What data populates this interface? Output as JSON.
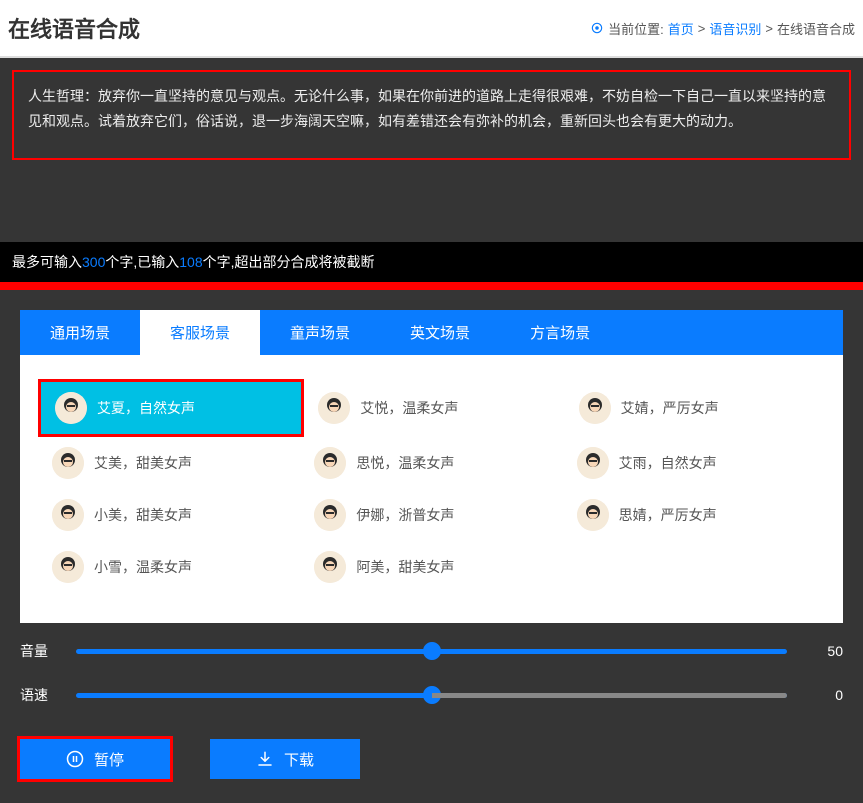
{
  "header": {
    "title": "在线语音合成",
    "breadcrumb_label": "当前位置:",
    "crumb_home": "首页",
    "crumb_mid": "语音识别",
    "crumb_last": "在线语音合成",
    "sep": ">"
  },
  "input": {
    "text": "人生哲理：放弃你一直坚持的意见与观点。无论什么事，如果在你前进的道路上走得很艰难，不妨自检一下自己一直以来坚持的意见和观点。试着放弃它们，俗话说，退一步海阔天空嘛，如有差错还会有弥补的机会，重新回头也会有更大的动力。"
  },
  "status": {
    "prefix": "最多可输入",
    "max": "300",
    "mid1": "个字,已输入",
    "current": "108",
    "suffix": "个字,超出部分合成将被截断"
  },
  "tabs": [
    {
      "label": "通用场景",
      "active": false
    },
    {
      "label": "客服场景",
      "active": true
    },
    {
      "label": "童声场景",
      "active": false
    },
    {
      "label": "英文场景",
      "active": false
    },
    {
      "label": "方言场景",
      "active": false
    }
  ],
  "voices": {
    "row0": [
      {
        "label": "艾夏，自然女声",
        "selected": true
      },
      {
        "label": "艾悦，温柔女声"
      },
      {
        "label": "艾婧，严厉女声"
      }
    ],
    "row1": [
      {
        "label": "艾美，甜美女声"
      },
      {
        "label": "思悦，温柔女声"
      },
      {
        "label": "艾雨，自然女声"
      }
    ],
    "row2": [
      {
        "label": "小美，甜美女声"
      },
      {
        "label": "伊娜，浙普女声"
      },
      {
        "label": "思婧，严厉女声"
      }
    ],
    "row3": [
      {
        "label": "小雪，温柔女声"
      },
      {
        "label": "阿美，甜美女声"
      },
      {
        "label": "",
        "empty": true
      }
    ]
  },
  "sliders": {
    "volume_label": "音量",
    "volume_value": "50",
    "speed_label": "语速",
    "speed_value": "0"
  },
  "actions": {
    "pause": "暂停",
    "download": "下载"
  }
}
